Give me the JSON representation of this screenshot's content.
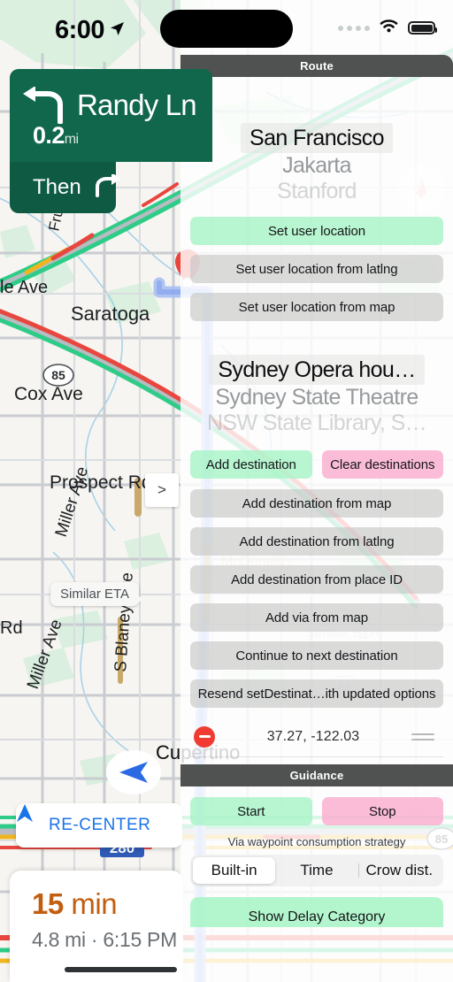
{
  "status_bar": {
    "time": "6:00",
    "location_icon": "location-arrow-icon",
    "wifi_icon": "wifi-icon",
    "battery_icon": "battery-full-icon",
    "signal_icon": "signal-dots-icon"
  },
  "nav_banner": {
    "maneuver_icon": "turn-left-arrow-icon",
    "street": "Randy Ln",
    "distance": "0.2",
    "distance_unit": "mi",
    "then_label": "Then",
    "then_icon": "turn-right-arrow-icon"
  },
  "map": {
    "labels": [
      "le Ave",
      "Saratoga",
      "Cox Ave",
      "Prospect Rd",
      "Miller Ave",
      "Miller Ave",
      "S Blaney Ave",
      "Rd",
      "Fruitv",
      "Cupertino"
    ],
    "shields": [
      "85",
      "85",
      "280"
    ],
    "similar_eta": "Similar ETA",
    "chevron": ">",
    "recenter_label": "RE-CENTER",
    "recenter_icon": "navigation-arrow-icon",
    "pin_icon": "map-pin-icon",
    "puck_icon": "navigation-puck-icon",
    "compass_icon": "compass-needle-icon"
  },
  "eta_card": {
    "duration_value": "15",
    "duration_unit": "min",
    "detail": "4.8 mi · 6:15 PM"
  },
  "panel": {
    "route_header": "Route",
    "guidance_header": "Guidance",
    "origin_field": "San Francisco",
    "origin_suggestions": [
      "Jakarta",
      "Stanford"
    ],
    "location_buttons": [
      {
        "label": "Set user location",
        "style": "green"
      },
      {
        "label": "Set user location from latlng",
        "style": "gray"
      },
      {
        "label": "Set user location from map",
        "style": "gray"
      }
    ],
    "destination_field": "Sydney Opera hou…",
    "destination_suggestions": [
      "Sydney State Theatre",
      "NSW State Library, S…"
    ],
    "destination_row": [
      {
        "label": "Add destination",
        "style": "green"
      },
      {
        "label": "Clear destinations",
        "style": "pink"
      }
    ],
    "destination_buttons": [
      {
        "label": "Add destination from map",
        "style": "gray"
      },
      {
        "label": "Add destination from latlng",
        "style": "gray"
      },
      {
        "label": "Add destination from place ID",
        "style": "gray"
      },
      {
        "label": "Add via from map",
        "style": "gray"
      },
      {
        "label": "Continue to next destination",
        "style": "gray"
      },
      {
        "label": "Resend setDestinat…ith updated options",
        "style": "gray"
      }
    ],
    "waypoint_row": {
      "delete_icon": "minus-circle-icon",
      "coordinates": "37.27,  -122.03",
      "drag_icon": "drag-handle-icon"
    },
    "guidance_row": [
      {
        "label": "Start",
        "style": "green"
      },
      {
        "label": "Stop",
        "style": "pink"
      }
    ],
    "strategy_caption": "Via waypoint consumption strategy",
    "strategy_options": [
      {
        "label": "Built-in",
        "selected": true
      },
      {
        "label": "Time",
        "selected": false
      },
      {
        "label": "Crow dist.",
        "selected": false
      }
    ],
    "bottom_button": "Show Delay Category"
  },
  "colors": {
    "nav_green": "#11674c",
    "accent_green": "#a6f4c6",
    "accent_pink": "#fab0d0",
    "eta_orange": "#c25e10",
    "link_blue": "#1a73e8",
    "header_gray": "#4f5250",
    "delete_red": "#f03a32"
  }
}
